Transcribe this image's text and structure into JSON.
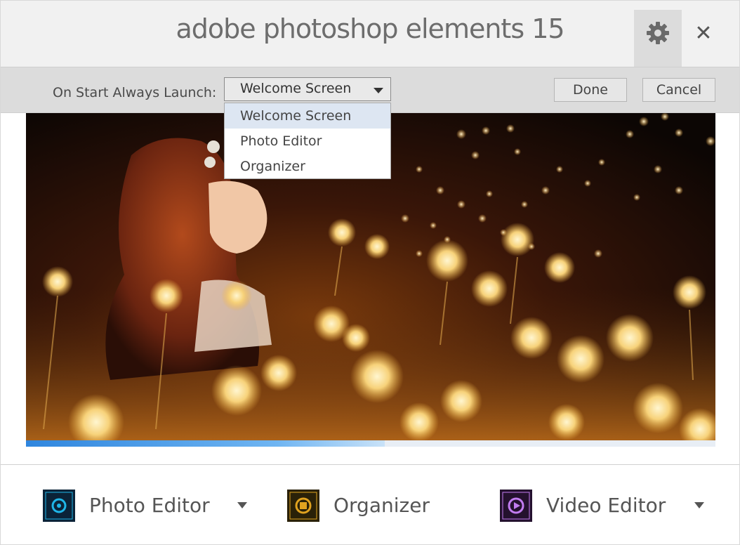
{
  "window": {
    "title": "adobe photoshop elements 15",
    "close_symbol": "✕",
    "settings_icon": "gear-icon"
  },
  "settings": {
    "launch_label": "On Start Always Launch:",
    "select_value": "Welcome Screen",
    "options": [
      "Welcome Screen",
      "Photo Editor",
      "Organizer"
    ],
    "done_label": "Done",
    "cancel_label": "Cancel"
  },
  "hero": {
    "progress": 0.52,
    "progress_color": "#2f86de"
  },
  "launchers": [
    {
      "label": "Photo Editor",
      "icon": "photo-editor-icon",
      "accent": "#1fb6e8",
      "bg": "#0b2338"
    },
    {
      "label": "Organizer",
      "icon": "organizer-icon",
      "accent": "#e0a21f",
      "bg": "#2a2108"
    },
    {
      "label": "Video Editor",
      "icon": "video-editor-icon",
      "accent": "#c27cf0",
      "bg": "#24112e"
    }
  ]
}
